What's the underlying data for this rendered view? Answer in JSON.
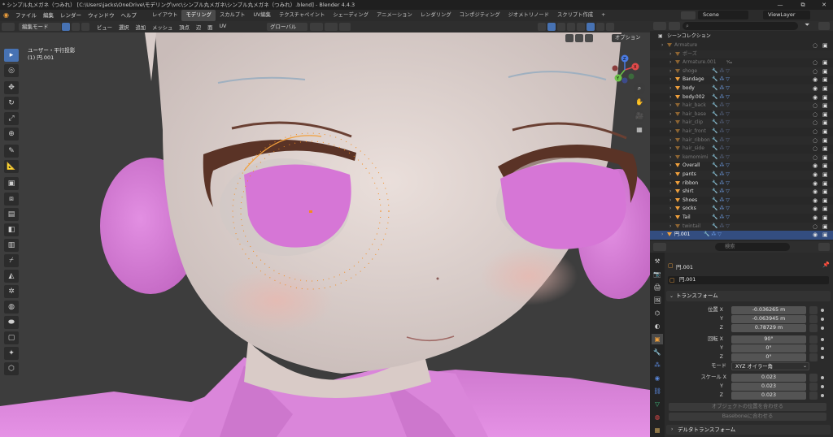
{
  "window": {
    "title": "* シンプル丸メガネ（つみれ） [C:\\Users\\jacks\\OneDrive\\モデリング\\vrc\\シンプル丸メガネ\\シンプル丸メガネ（つみれ）.blend] - Blender 4.4.3",
    "minimize": "—",
    "maximize": "⧉",
    "close": "✕"
  },
  "menu": [
    "ファイル",
    "編集",
    "レンダー",
    "ウィンドウ",
    "ヘルプ"
  ],
  "workspaces": [
    {
      "label": "レイアウト",
      "active": false
    },
    {
      "label": "モデリング",
      "active": true
    },
    {
      "label": "スカルプト",
      "active": false
    },
    {
      "label": "UV編集",
      "active": false
    },
    {
      "label": "テクスチャペイント",
      "active": false
    },
    {
      "label": "シェーディング",
      "active": false
    },
    {
      "label": "アニメーション",
      "active": false
    },
    {
      "label": "レンダリング",
      "active": false
    },
    {
      "label": "コンポジティング",
      "active": false
    },
    {
      "label": "ジオメトリノード",
      "active": false
    },
    {
      "label": "スクリプト作成",
      "active": false
    }
  ],
  "workspace_add": "+",
  "scene": {
    "label": "Scene",
    "viewlayer": "ViewLayer"
  },
  "viewport_header": {
    "mode": "編集モード",
    "menus": [
      "ビュー",
      "選択",
      "追加",
      "メッシュ",
      "頂点",
      "辺",
      "面",
      "UV"
    ],
    "orientation": "グローバル",
    "options": "オプション"
  },
  "viewport": {
    "view_name": "ユーザー・平行投影",
    "object_label": "(1) 円.001",
    "gizmo_axes": [
      "X",
      "Y",
      "Z"
    ]
  },
  "outliner": {
    "search_placeholder": "",
    "root": "シーンコレクション",
    "rows": [
      {
        "name": "Armature",
        "dim": true,
        "indent": 1
      },
      {
        "name": "ポーズ",
        "dim": true,
        "indent": 2
      },
      {
        "name": "Armature.001",
        "dim": true,
        "indent": 2,
        "extra": "¹⁄₄₄"
      },
      {
        "name": "shoge",
        "dim": true,
        "indent": 2
      },
      {
        "name": "Bandage",
        "dim": false,
        "indent": 2
      },
      {
        "name": "body",
        "dim": false,
        "indent": 2
      },
      {
        "name": "body.002",
        "dim": false,
        "indent": 2
      },
      {
        "name": "hair_back",
        "dim": true,
        "indent": 2
      },
      {
        "name": "hair_base",
        "dim": true,
        "indent": 2
      },
      {
        "name": "hair_clip",
        "dim": true,
        "indent": 2
      },
      {
        "name": "hair_front",
        "dim": true,
        "indent": 2
      },
      {
        "name": "hair_ribbon",
        "dim": true,
        "indent": 2
      },
      {
        "name": "hair_side",
        "dim": true,
        "indent": 2
      },
      {
        "name": "kemomimi",
        "dim": true,
        "indent": 2
      },
      {
        "name": "Overall",
        "dim": false,
        "indent": 2
      },
      {
        "name": "pants",
        "dim": false,
        "indent": 2
      },
      {
        "name": "ribbon",
        "dim": false,
        "indent": 2
      },
      {
        "name": "shirt",
        "dim": false,
        "indent": 2
      },
      {
        "name": "Shoes",
        "dim": false,
        "indent": 2
      },
      {
        "name": "socks",
        "dim": false,
        "indent": 2
      },
      {
        "name": "Tail",
        "dim": false,
        "indent": 2
      },
      {
        "name": "twintail",
        "dim": true,
        "indent": 2
      },
      {
        "name": "円.001",
        "dim": false,
        "indent": 1,
        "selected": true
      }
    ]
  },
  "properties": {
    "search_placeholder": "検索",
    "object_name": "円.001",
    "datablock": "円.001",
    "transform_header": "トランスフォーム",
    "location_label": "位置",
    "rotation_label": "回転",
    "scale_label": "スケール",
    "location": {
      "x": "-0.036265 m",
      "y": "-0.063945 m",
      "z": "0.78729 m"
    },
    "rotation": {
      "x": "90°",
      "y": "0°",
      "z": "0°"
    },
    "mode_label": "モード",
    "mode_value": "XYZ オイラー角",
    "scale": {
      "x": "0.023",
      "y": "0.023",
      "z": "0.023"
    },
    "btn_match_object": "オブジェクトの位置を合わせる",
    "btn_match_bone": "Baseboneに合わせる",
    "delta_header": "デルタトランスフォーム"
  },
  "colors": {
    "accent": "#4772b3",
    "object_orange": "#f0a03c",
    "iris": "#d676d6",
    "skin": "#e5dcd8"
  }
}
